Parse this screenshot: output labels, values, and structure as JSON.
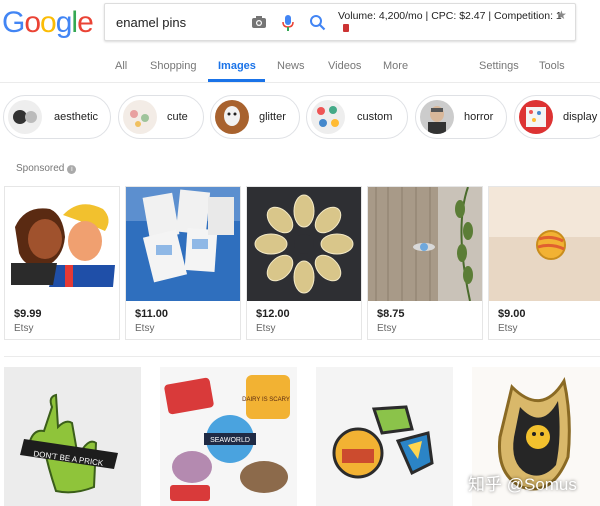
{
  "logo": {
    "letters": [
      "G",
      "o",
      "o",
      "g",
      "l",
      "e"
    ],
    "colors": [
      "#4285F4",
      "#EA4335",
      "#FBBC05",
      "#4285F4",
      "#34A853",
      "#EA4335"
    ]
  },
  "search": {
    "query": "enamel pins",
    "keyword_stats": "Volume: 4,200/mo | CPC: $2.47 | Competition: 1"
  },
  "tabs": [
    {
      "label": "All"
    },
    {
      "label": "Shopping"
    },
    {
      "label": "Images",
      "active": true
    },
    {
      "label": "News"
    },
    {
      "label": "Videos"
    },
    {
      "label": "More"
    },
    {
      "label": "Settings"
    },
    {
      "label": "Tools"
    }
  ],
  "chips": [
    {
      "label": "aesthetic"
    },
    {
      "label": "cute"
    },
    {
      "label": "glitter"
    },
    {
      "label": "custom"
    },
    {
      "label": "horror"
    },
    {
      "label": "display"
    }
  ],
  "sponsored_label": "Sponsored",
  "products": [
    {
      "price": "$9.99",
      "seller": "Etsy"
    },
    {
      "price": "$11.00",
      "seller": "Etsy"
    },
    {
      "price": "$12.00",
      "seller": "Etsy"
    },
    {
      "price": "$8.75",
      "seller": "Etsy"
    },
    {
      "price": "$9.00",
      "seller": "Etsy"
    }
  ],
  "results": {
    "pin1_text": "DON'T BE A PRICK",
    "pin2_text": "SEAWORLD",
    "pin2_text2": "DAIRY IS SCARY"
  },
  "watermark": "知乎 @Somus",
  "colors": {
    "accent": "#1a73e8"
  }
}
